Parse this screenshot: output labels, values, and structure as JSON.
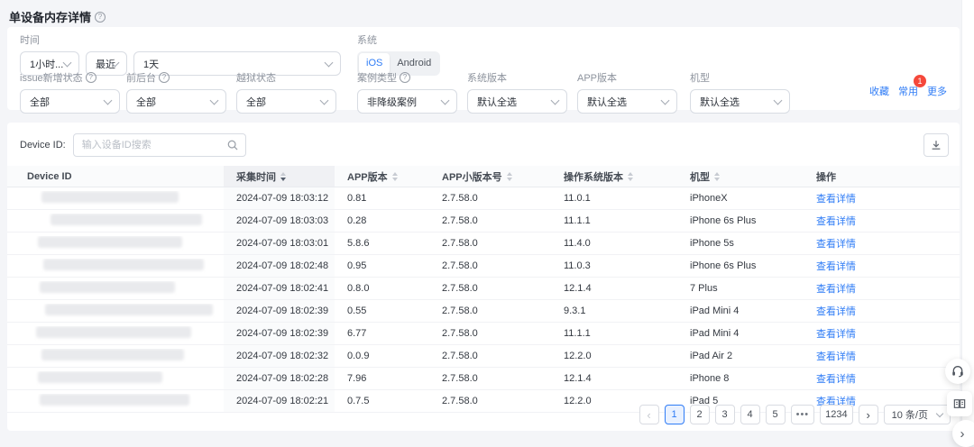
{
  "page": {
    "title": "单设备内存详情"
  },
  "filters": {
    "time": {
      "label": "时间",
      "granularity": "1小时...",
      "mode": "最近",
      "duration": "1天"
    },
    "system": {
      "label": "系统",
      "options": [
        "iOS",
        "Android"
      ],
      "selected": "iOS"
    },
    "selects": [
      {
        "label": "issue新增状态",
        "value": "全部"
      },
      {
        "label": "前后台",
        "value": "全部"
      },
      {
        "label": "越狱状态",
        "value": "全部"
      },
      {
        "label": "案例类型",
        "value": "非降级案例"
      },
      {
        "label": "系统版本",
        "value": "默认全选"
      },
      {
        "label": "APP版本",
        "value": "默认全选"
      },
      {
        "label": "机型",
        "value": "默认全选"
      }
    ],
    "actions": {
      "favorite": "收藏",
      "frequent": "常用",
      "frequent_badge": "1",
      "more": "更多"
    }
  },
  "table": {
    "search": {
      "label": "Device ID:",
      "placeholder": "输入设备ID搜索"
    },
    "columns": [
      "Device ID",
      "采集时间",
      "APP版本",
      "APP小版本号",
      "操作系统版本",
      "机型",
      "操作"
    ],
    "sorted_column": "采集时间",
    "sort_order": "desc",
    "action_label": "查看详情",
    "rows": [
      {
        "time": "2024-07-09 18:03:12",
        "app_version": "0.81",
        "app_minor": "2.7.58.0",
        "os_version": "11.0.1",
        "model": "iPhoneX"
      },
      {
        "time": "2024-07-09 18:03:03",
        "app_version": "0.28",
        "app_minor": "2.7.58.0",
        "os_version": "11.1.1",
        "model": "iPhone 6s Plus"
      },
      {
        "time": "2024-07-09 18:03:01",
        "app_version": "5.8.6",
        "app_minor": "2.7.58.0",
        "os_version": "11.4.0",
        "model": "iPhone 5s"
      },
      {
        "time": "2024-07-09 18:02:48",
        "app_version": "0.95",
        "app_minor": "2.7.58.0",
        "os_version": "11.0.3",
        "model": "iPhone 6s Plus"
      },
      {
        "time": "2024-07-09 18:02:41",
        "app_version": "0.8.0",
        "app_minor": "2.7.58.0",
        "os_version": "12.1.4",
        "model": "7 Plus"
      },
      {
        "time": "2024-07-09 18:02:39",
        "app_version": "0.55",
        "app_minor": "2.7.58.0",
        "os_version": "9.3.1",
        "model": "iPad Mini 4"
      },
      {
        "time": "2024-07-09 18:02:39",
        "app_version": "6.77",
        "app_minor": "2.7.58.0",
        "os_version": "11.1.1",
        "model": "iPad Mini 4"
      },
      {
        "time": "2024-07-09 18:02:32",
        "app_version": "0.0.9",
        "app_minor": "2.7.58.0",
        "os_version": "12.2.0",
        "model": "iPad Air 2"
      },
      {
        "time": "2024-07-09 18:02:28",
        "app_version": "7.96",
        "app_minor": "2.7.58.0",
        "os_version": "12.1.4",
        "model": "iPhone 8"
      },
      {
        "time": "2024-07-09 18:02:21",
        "app_version": "0.7.5",
        "app_minor": "2.7.58.0",
        "os_version": "12.2.0",
        "model": "iPad 5"
      }
    ]
  },
  "pagination": {
    "current": "1",
    "pages": [
      "1",
      "2",
      "3",
      "4",
      "5"
    ],
    "ellipsis": "•••",
    "last_page": "1234",
    "page_size": "10 条/页"
  },
  "colors": {
    "primary": "#2f7cf6",
    "badge": "#f5483b"
  }
}
